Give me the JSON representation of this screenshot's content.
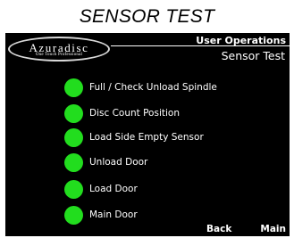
{
  "page": {
    "title": "SENSOR TEST"
  },
  "logo": {
    "name": "Azuradisc",
    "tagline": "One Touch Professional"
  },
  "header": {
    "title": "User Operations",
    "subtitle": "Sensor Test"
  },
  "sensors": [
    {
      "label": "Full / Check Unload Spindle",
      "status_color": "#22dd1e"
    },
    {
      "label": "Disc Count Position",
      "status_color": "#22dd1e"
    },
    {
      "label": "Load Side Empty Sensor",
      "status_color": "#22dd1e"
    },
    {
      "label": "Unload Door",
      "status_color": "#22dd1e"
    },
    {
      "label": "Load Door",
      "status_color": "#22dd1e"
    },
    {
      "label": "Main Door",
      "status_color": "#22dd1e"
    }
  ],
  "footer": {
    "back_label": "Back",
    "main_label": "Main"
  }
}
